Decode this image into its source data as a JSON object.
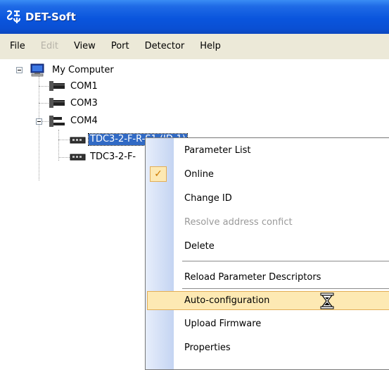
{
  "window": {
    "title": "DET-Soft",
    "titlebar_color": "#0a55dd"
  },
  "menubar": {
    "items": [
      {
        "label": "File",
        "enabled": true
      },
      {
        "label": "Edit",
        "enabled": false
      },
      {
        "label": "View",
        "enabled": true
      },
      {
        "label": "Port",
        "enabled": true
      },
      {
        "label": "Detector",
        "enabled": true
      },
      {
        "label": "Help",
        "enabled": true
      }
    ]
  },
  "tree": {
    "root": {
      "label": "My Computer",
      "icon": "computer-icon",
      "expanded": true
    },
    "ports": [
      {
        "label": "COM1",
        "icon": "port-icon"
      },
      {
        "label": "COM3",
        "icon": "port-icon"
      },
      {
        "label": "COM4",
        "icon": "port-icon",
        "expanded": true
      }
    ],
    "detectors": [
      {
        "label": "TDC3-2-F-R-S1 (ID-1)",
        "visible_label": "TDC3-2-F-R-S1 (ID-1)",
        "icon": "detector-icon",
        "selected": true
      },
      {
        "label": "TDC3-2-F-",
        "icon": "detector-icon",
        "selected": false
      }
    ]
  },
  "context_menu": {
    "items": [
      {
        "label": "Parameter List",
        "enabled": true
      },
      {
        "label": "Online",
        "enabled": true,
        "checked": true
      },
      {
        "label": "Change ID",
        "enabled": true
      },
      {
        "label": "Resolve address confict",
        "enabled": false
      },
      {
        "label": "Delete",
        "enabled": true
      },
      {
        "label": "Reload Parameter Descriptors",
        "enabled": true
      },
      {
        "label": "Auto-configuration",
        "enabled": true,
        "highlighted": true
      },
      {
        "label": "Upload Firmware",
        "enabled": true
      },
      {
        "label": "Properties",
        "enabled": true
      }
    ],
    "highlight_color": "#fde9b3"
  },
  "cursor": {
    "icon": "hourglass-icon"
  }
}
